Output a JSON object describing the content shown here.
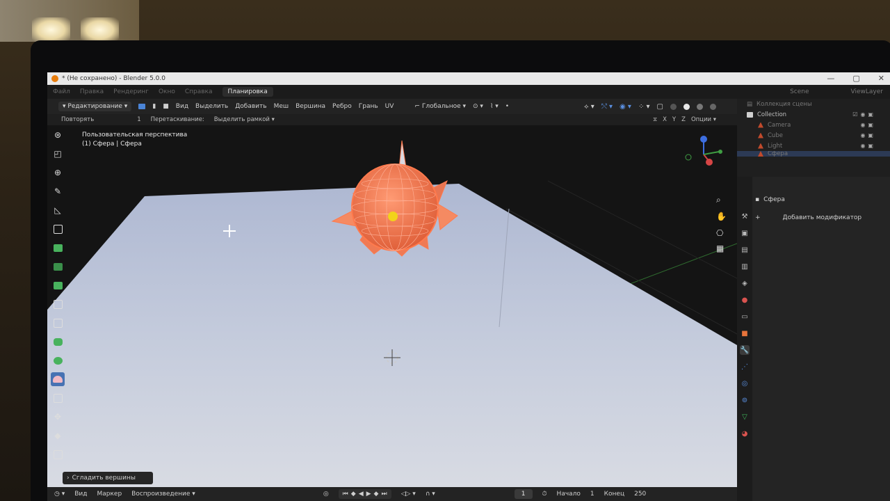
{
  "window": {
    "title": "* (Не сохранено) - Blender 5.0.0",
    "controls": [
      "—",
      "▢",
      "✕"
    ]
  },
  "menubar": {
    "items": [
      "Файл",
      "Правка",
      "Рендеринг",
      "Окно",
      "Справка"
    ],
    "active_workspace": "Планировка",
    "scene": "Scene",
    "view_layer": "ViewLayer"
  },
  "viewport_header": {
    "mode": "Редактирование",
    "menus": [
      "Вид",
      "Выделить",
      "Добавить",
      "Меш",
      "Вершина",
      "Ребро",
      "Грань",
      "UV"
    ],
    "orientation": "Глобальное"
  },
  "tool_header": {
    "repeat_label": "Повторять",
    "repeat_value": "1",
    "drag_label": "Перетаскивание:",
    "drag_value": "Выделить рамкой",
    "axes": [
      "X",
      "Y",
      "Z"
    ],
    "options": "Опции"
  },
  "viewport": {
    "view_name": "Пользовательская перспектива",
    "object_info": "(1) Сфера | Сфера"
  },
  "last_operation": {
    "label": "Сгладить вершины"
  },
  "timeline": {
    "menus": [
      "Вид",
      "Маркер",
      "Воспроизведение"
    ],
    "current_frame": "1",
    "start_label": "Начало",
    "start_value": "1",
    "end_label": "Конец",
    "end_value": "250"
  },
  "outliner": {
    "header": "Коллекция сцены",
    "collection": "Collection",
    "items": [
      "Camera",
      "Cube",
      "Light",
      "Сфера"
    ]
  },
  "properties": {
    "object_name": "Сфера",
    "add_modifier": "Добавить модификатор"
  },
  "colors": {
    "accent": "#4772b3",
    "selection_orange": "#ff7a4d",
    "origin_yellow": "#f2d21b"
  }
}
